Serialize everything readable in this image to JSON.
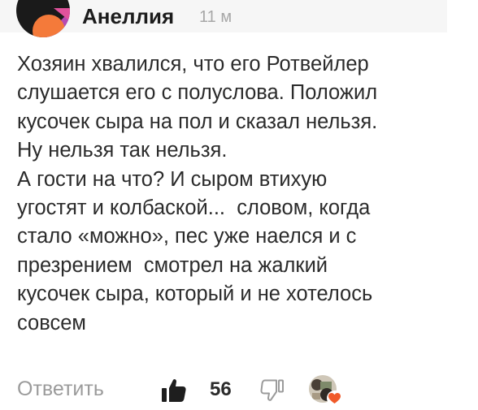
{
  "comment": {
    "author": "Анеллия",
    "time": "11 м",
    "lines": [
      "Хозяин хвалился, что его Ротвейлер",
      "слушается его с полуслова. Положил",
      "кусочек сыра на пол и сказал нельзя.",
      "Ну нельзя так нельзя.",
      "А гости на что? И сыром втихую",
      "угостят и колбаской...  словом, когда",
      "стало «можно», пес уже наелся и с",
      "презрением  смотрел на жалкий",
      "кусочек сыра, который и не хотелось",
      "совсем"
    ]
  },
  "actions": {
    "reply_label": "Ответить",
    "like_count": "56"
  },
  "icons": {
    "avatar": "avatar-abstract-icon",
    "like": "thumbs-up-icon",
    "dislike": "thumbs-down-icon",
    "reactor": "reactor-avatar",
    "heart": "heart-icon"
  },
  "colors": {
    "avatar_dark": "#1a1a1a",
    "avatar_orange": "#f47a3a",
    "avatar_pink": "#e0529c",
    "avatar_purple": "#7a3fd1",
    "header_background": "#f6f6f6",
    "secondary_text": "#a7a7a7",
    "heart": "#f05a2a"
  }
}
